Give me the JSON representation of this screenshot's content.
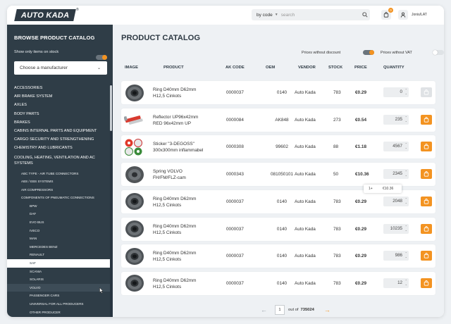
{
  "brand": {
    "logo_text": "AUTO KADA",
    "reg": "®"
  },
  "header": {
    "search_mode": "by code",
    "search_placeholder": "search",
    "cart_count": "0",
    "user_name": "Jonis/LAT"
  },
  "sidebar": {
    "title": "BROWSE PRODUCT CATALOG",
    "stock_toggle_label": "Show only items on stock",
    "stock_toggle_on": true,
    "manufacturer_placeholder": "Choose a manufacturer",
    "categories": [
      "ACCESSORIES",
      "AIR BRAKE SYSTEM",
      "AXLES",
      "BODY PARTS",
      "BRAKES",
      "CABINS INTERNAL PARTS AND EQUIPMENT",
      "CARGO SECURITY AND STRENGTHENING",
      "CHEMISTRY AND LUBRICANTS"
    ],
    "expanded_category": "COOLING, HEATING, VENTILATION AND AC SYSTEMS",
    "subcategories": [
      "ABC TYPE - AIR TUBE CONNECTORS",
      "ABS / EBS SYSTEMS",
      "AIR COMPRESSORS",
      "COMPONENTS OF PNEUMATIC CONNECTIONS"
    ],
    "brands": [
      "BPW",
      "DAF",
      "EVO BUS",
      "IVECO",
      "MAN",
      "MERCEDES BENZ",
      "RENAULT",
      "SAF",
      "SCANIA",
      "SOLARIS",
      "VOLVO",
      "PASSENGER CARS",
      "UNIVERSAL FOR ALL PRODUCERS",
      "OTHER PRODUCER"
    ],
    "active_brand": "SAF",
    "hover_brand": "VOLVO"
  },
  "main": {
    "title": "PRODUCT CATALOG",
    "toggle_discount_label": "Prices without discount",
    "toggle_discount_on": true,
    "toggle_vat_label": "Prices without VAT",
    "toggle_vat_on": false,
    "columns": [
      "IMAGE",
      "PRODUCT",
      "AK CODE",
      "OEM",
      "VENDOR",
      "STOCK",
      "PRICE",
      "QUANTITY"
    ],
    "rows": [
      {
        "line1": "Ring D40mm D62mm",
        "line2": "H12,5 Cinkots",
        "code": "0000037",
        "oem": "0140",
        "vendor": "Auto Kada",
        "stock": "783",
        "price": "€0.29",
        "qty": "0",
        "cart_enabled": false,
        "img": "ring"
      },
      {
        "line1": "Reflector UP96x42mm",
        "line2": "RED 96x42mm UP",
        "code": "0000084",
        "oem": "AK848",
        "vendor": "Auto Kada",
        "stock": "273",
        "price": "€0.54",
        "qty": "235",
        "cart_enabled": true,
        "img": "reflector"
      },
      {
        "line1": "Sticker \"3-DEGOSS\"",
        "line2": "300x300mm inflammabel",
        "code": "0000308",
        "oem": "99602",
        "vendor": "Auto Kada",
        "stock": "88",
        "price": "€1.18",
        "qty": "4567",
        "cart_enabled": true,
        "img": "sticker"
      },
      {
        "line1": "Spring VOLVO",
        "line2": "FH/FM/FLZ-cam",
        "code": "0000343",
        "oem": "081050101",
        "vendor": "Auto Kada",
        "stock": "50",
        "price": "€10.36",
        "qty": "2345",
        "cart_enabled": true,
        "img": "spring"
      },
      {
        "line1": "Ring D40mm D62mm",
        "line2": "H12,5 Cinkots",
        "code": "0000037",
        "oem": "0140",
        "vendor": "Auto Kada",
        "stock": "783",
        "price": "€0.29",
        "qty": "2048",
        "cart_enabled": true,
        "img": "ring"
      },
      {
        "line1": "Ring D40mm D62mm",
        "line2": "H12,5 Cinkots",
        "code": "0000037",
        "oem": "0140",
        "vendor": "Auto Kada",
        "stock": "783",
        "price": "€0.29",
        "qty": "10235",
        "cart_enabled": true,
        "img": "ring"
      },
      {
        "line1": "Ring D40mm D62mm",
        "line2": "H12,5 Cinkots",
        "code": "0000037",
        "oem": "0140",
        "vendor": "Auto Kada",
        "stock": "783",
        "price": "€0.29",
        "qty": "986",
        "cart_enabled": true,
        "img": "ring"
      },
      {
        "line1": "Ring D40mm D62mm",
        "line2": "H12,5 Cinkots",
        "code": "0000037",
        "oem": "0140",
        "vendor": "Auto Kada",
        "stock": "783",
        "price": "€0.29",
        "qty": "12",
        "cart_enabled": true,
        "img": "ring"
      }
    ],
    "tooltip": {
      "qty": "1+",
      "price": "€10.36"
    },
    "pagination": {
      "current": "1",
      "of_label": "out of",
      "total": "735024"
    }
  },
  "colors": {
    "accent": "#f39321",
    "sidebar_bg": "#2f3d47",
    "page_bg": "#eef1f4"
  }
}
